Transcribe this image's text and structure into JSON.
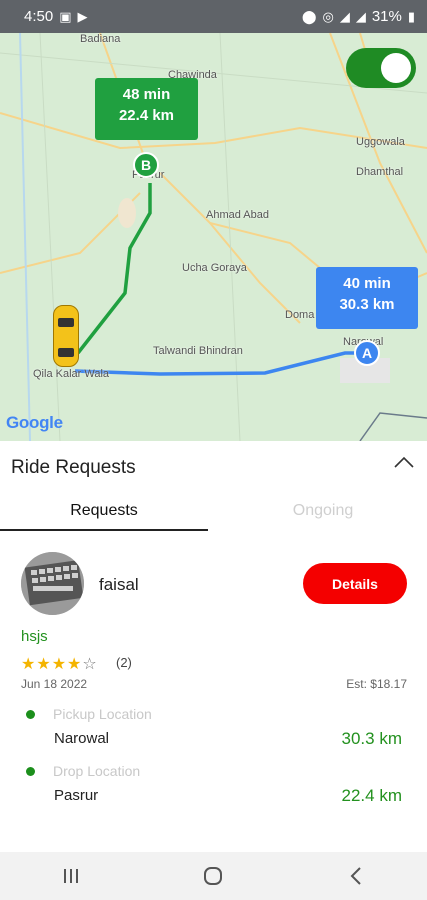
{
  "status_bar": {
    "time": "4:50",
    "battery": "31%",
    "left_icons": [
      "image-icon",
      "youtube-icon"
    ],
    "right_icons": [
      "location-icon",
      "hotspot-icon",
      "signal-icon",
      "wifi-signal-icon",
      "battery-icon"
    ]
  },
  "map": {
    "toggle_on": true,
    "route_b": {
      "time": "48 min",
      "distance": "22.4 km",
      "marker": "B",
      "color": "#20a040"
    },
    "route_a": {
      "time": "40 min",
      "distance": "30.3 km",
      "marker": "A",
      "color": "#3d86f0"
    },
    "labels": [
      "Badiana",
      "Chawinda",
      "Uggowala",
      "Dhamthal",
      "Pasrur",
      "Ahmad Abad",
      "Ucha Goraya",
      "Doma",
      "Narowal",
      "Talwandi Bhindran",
      "Qila Kalar Wala"
    ],
    "google_logo": "Google"
  },
  "panel": {
    "title": "Ride Requests",
    "tabs": [
      "Requests",
      "Ongoing"
    ],
    "active_tab": 0
  },
  "request": {
    "username": "faisal",
    "details_label": "Details",
    "note": "hsjs",
    "rating": 4,
    "rating_max": 5,
    "rating_count": "(2)",
    "date": "Jun 18 2022",
    "estimate": "Est: $18.17",
    "pickup": {
      "label": "Pickup Location",
      "value": "Narowal",
      "distance": "30.3 km"
    },
    "drop": {
      "label": "Drop Location",
      "value": "Pasrur",
      "distance": "22.4 km"
    }
  },
  "nav_bar": {
    "icons": [
      "recent-apps-icon",
      "home-icon",
      "back-icon"
    ]
  }
}
